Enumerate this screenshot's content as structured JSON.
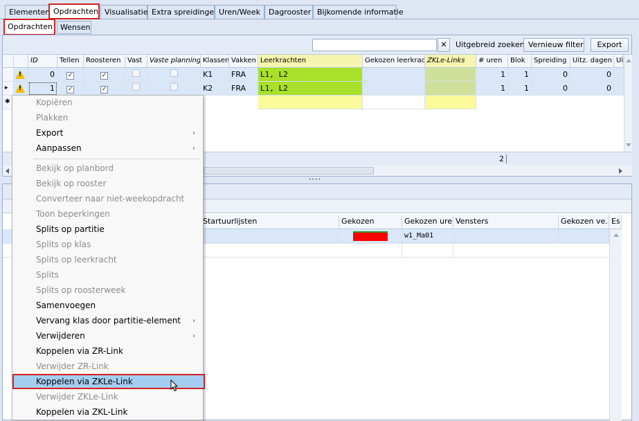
{
  "tabs": [
    "Elementen",
    "Opdrachten",
    "Visualisatie",
    "Extra spreidingen",
    "Uren/Week",
    "Dagrooster",
    "Bijkomende informatie"
  ],
  "subtabs": [
    "Opdrachten",
    "Wensen"
  ],
  "toolbar": {
    "clear": "✕",
    "advanced": "Uitgebreid zoeken",
    "refresh": "Vernieuw filter",
    "export": "Export"
  },
  "grid": {
    "headers": [
      "ID",
      "Tellen",
      "Roosteren",
      "Vast",
      "Vaste planning",
      "Klassen",
      "Vakken",
      "Leerkrachten",
      "Gekozen leerkrac...",
      "ZKLe-Links",
      "# uren",
      "Blok",
      "Spreiding",
      "Uitz. dagen",
      "Uit"
    ],
    "rows": [
      {
        "id": "0",
        "klassen": "K1",
        "vakken": "FRA",
        "leerkrachten": "L1, L2",
        "uren": "1",
        "blok": "1",
        "spreiding": "0",
        "uitz": "0"
      },
      {
        "id": "1",
        "klassen": "K2",
        "vakken": "FRA",
        "leerkrachten": "L1, L2",
        "uren": "1",
        "blok": "1",
        "spreiding": "0",
        "uitz": "0"
      }
    ],
    "count": "2",
    "check": "✓",
    "current_marker": "▸",
    "new_marker": "✱",
    "warning": "!"
  },
  "lower": {
    "headers": [
      "Startuurlijsten",
      "Gekozen",
      "Gekozen uren",
      "Vensters",
      "Gekozen ve...",
      "Es"
    ],
    "row": {
      "uren": "w1_Ma01"
    },
    "grip": "••••"
  },
  "menu": [
    {
      "label": "Kopiëren",
      "enabled": false
    },
    {
      "label": "Plakken",
      "enabled": false
    },
    {
      "label": "Export",
      "enabled": true,
      "sub": true
    },
    {
      "label": "Aanpassen",
      "enabled": true,
      "sub": true
    },
    {
      "label": "Bekijk op planbord",
      "enabled": false
    },
    {
      "label": "Bekijk op rooster",
      "enabled": false
    },
    {
      "label": "Converteer naar niet-weekopdracht",
      "enabled": false
    },
    {
      "label": "Toon beperkingen",
      "enabled": false
    },
    {
      "label": "Splits op partitie",
      "enabled": true
    },
    {
      "label": "Splits op klas",
      "enabled": false
    },
    {
      "label": "Splits op leerkracht",
      "enabled": false
    },
    {
      "label": "Splits",
      "enabled": false
    },
    {
      "label": "Splits op roosterweek",
      "enabled": false
    },
    {
      "label": "Samenvoegen",
      "enabled": true
    },
    {
      "label": "Vervang klas door partitie-element",
      "enabled": true,
      "sub": true
    },
    {
      "label": "Verwijderen",
      "enabled": true,
      "sub": true
    },
    {
      "label": "Koppelen via ZR-Link",
      "enabled": true
    },
    {
      "label": "Verwijder ZR-Link",
      "enabled": false
    },
    {
      "label": "Koppelen via ZKLe-Link",
      "enabled": true,
      "highlight": true
    },
    {
      "label": "Verwijder ZKLe-Link",
      "enabled": false
    },
    {
      "label": "Koppelen via ZKL-Link",
      "enabled": true
    }
  ],
  "colors": {
    "accent_red": "#d32020",
    "highlight": "#a5cdf2",
    "green": "#a8e02a",
    "yellow": "#fafa9a",
    "olive": "#dfe89a",
    "gekozen": "#ff0000"
  }
}
